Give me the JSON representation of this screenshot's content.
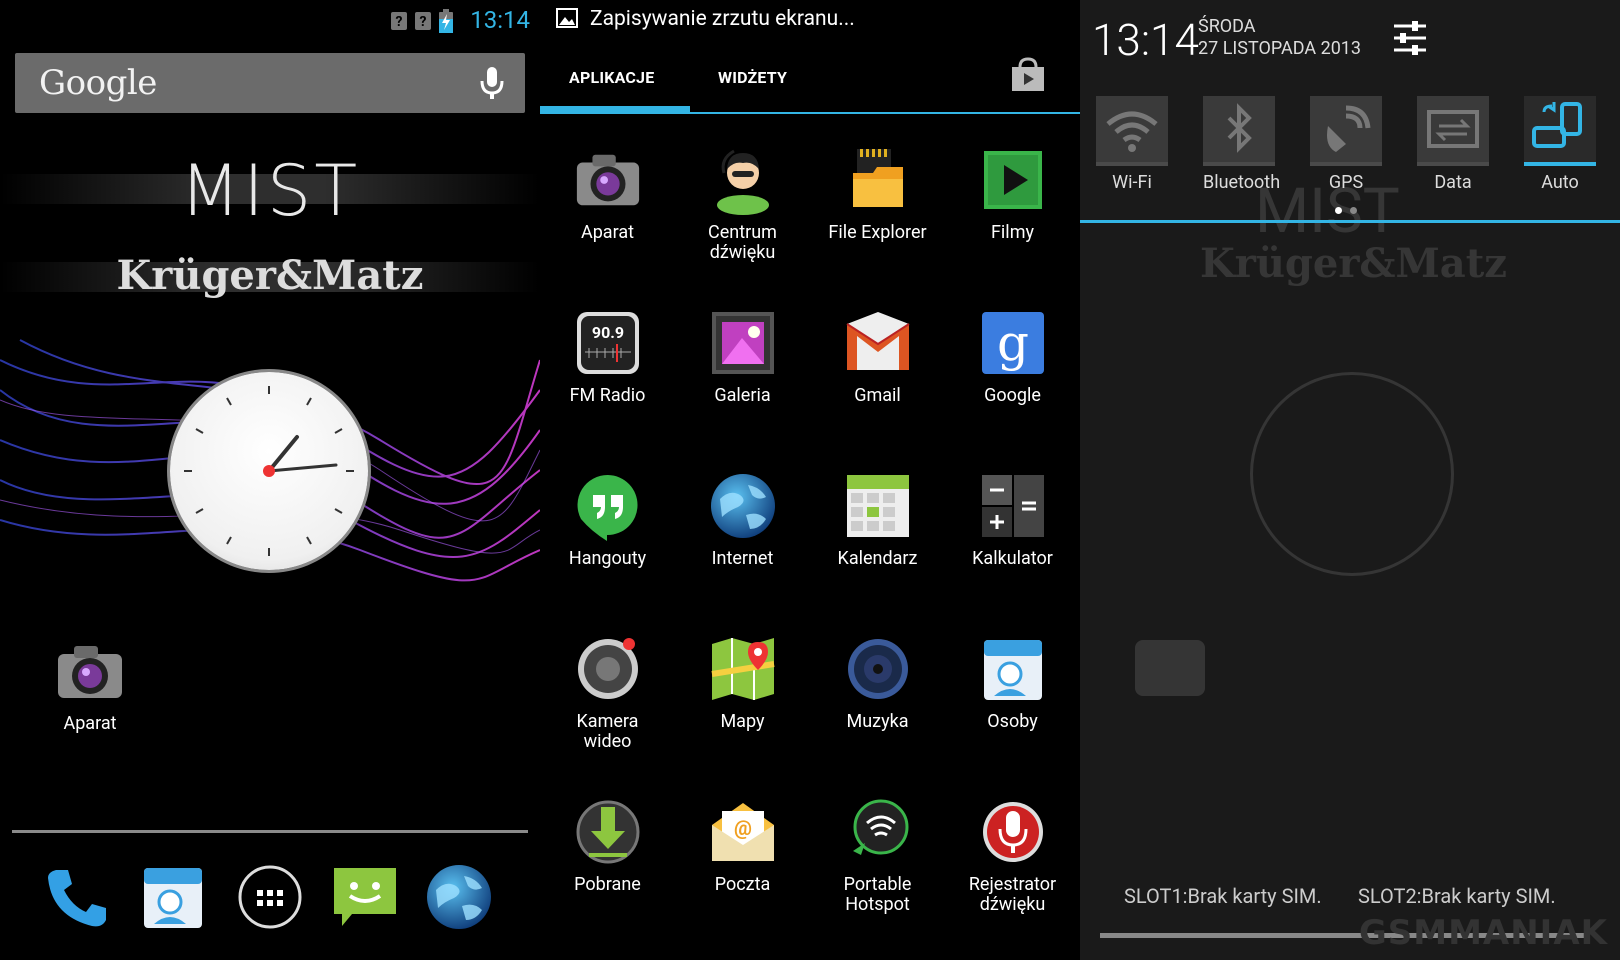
{
  "status": {
    "time": "13:14"
  },
  "home": {
    "search_brand": "Google",
    "brand_top": "MIST",
    "brand_bottom": "Krüger&Matz",
    "desktop_app": "Aparat"
  },
  "drawer": {
    "notification": "Zapisywanie zrzutu ekranu...",
    "tabs": [
      "APLIKACJE",
      "WIDŻETY"
    ],
    "apps": [
      {
        "label": "Aparat",
        "icon": "camera-icon"
      },
      {
        "label": "Centrum dźwięku",
        "icon": "sound-center-icon"
      },
      {
        "label": "File Explorer",
        "icon": "file-explorer-icon"
      },
      {
        "label": "Filmy",
        "icon": "movies-icon"
      },
      {
        "label": "FM Radio",
        "icon": "fm-radio-icon"
      },
      {
        "label": "Galeria",
        "icon": "gallery-icon"
      },
      {
        "label": "Gmail",
        "icon": "gmail-icon"
      },
      {
        "label": "Google",
        "icon": "google-icon"
      },
      {
        "label": "Hangouty",
        "icon": "hangouts-icon"
      },
      {
        "label": "Internet",
        "icon": "internet-globe-icon"
      },
      {
        "label": "Kalendarz",
        "icon": "calendar-icon"
      },
      {
        "label": "Kalkulator",
        "icon": "calculator-icon"
      },
      {
        "label": "Kamera wideo",
        "icon": "video-camera-icon"
      },
      {
        "label": "Mapy",
        "icon": "maps-icon"
      },
      {
        "label": "Muzyka",
        "icon": "music-icon"
      },
      {
        "label": "Osoby",
        "icon": "people-icon"
      },
      {
        "label": "Pobrane",
        "icon": "downloads-icon"
      },
      {
        "label": "Poczta",
        "icon": "email-icon"
      },
      {
        "label": "Portable Hotspot",
        "icon": "hotspot-icon"
      },
      {
        "label": "Rejestrator dźwięku",
        "icon": "sound-recorder-icon"
      }
    ]
  },
  "shade": {
    "time": "13:14",
    "day": "ŚRODA",
    "date": "27 LISTOPADA 2013",
    "quick_settings": [
      {
        "label": "Wi-Fi",
        "icon": "wifi-icon",
        "active": false
      },
      {
        "label": "Bluetooth",
        "icon": "bluetooth-icon",
        "active": false
      },
      {
        "label": "GPS",
        "icon": "gps-icon",
        "active": false
      },
      {
        "label": "Data",
        "icon": "data-icon",
        "active": false
      },
      {
        "label": "Auto",
        "icon": "auto-rotate-icon",
        "active": true
      }
    ],
    "sim1": "SLOT1:Brak karty SIM.",
    "sim2": "SLOT2:Brak karty SIM.",
    "watermark": "GSMMANIAK"
  },
  "colors": {
    "accent": "#33b5e5"
  }
}
